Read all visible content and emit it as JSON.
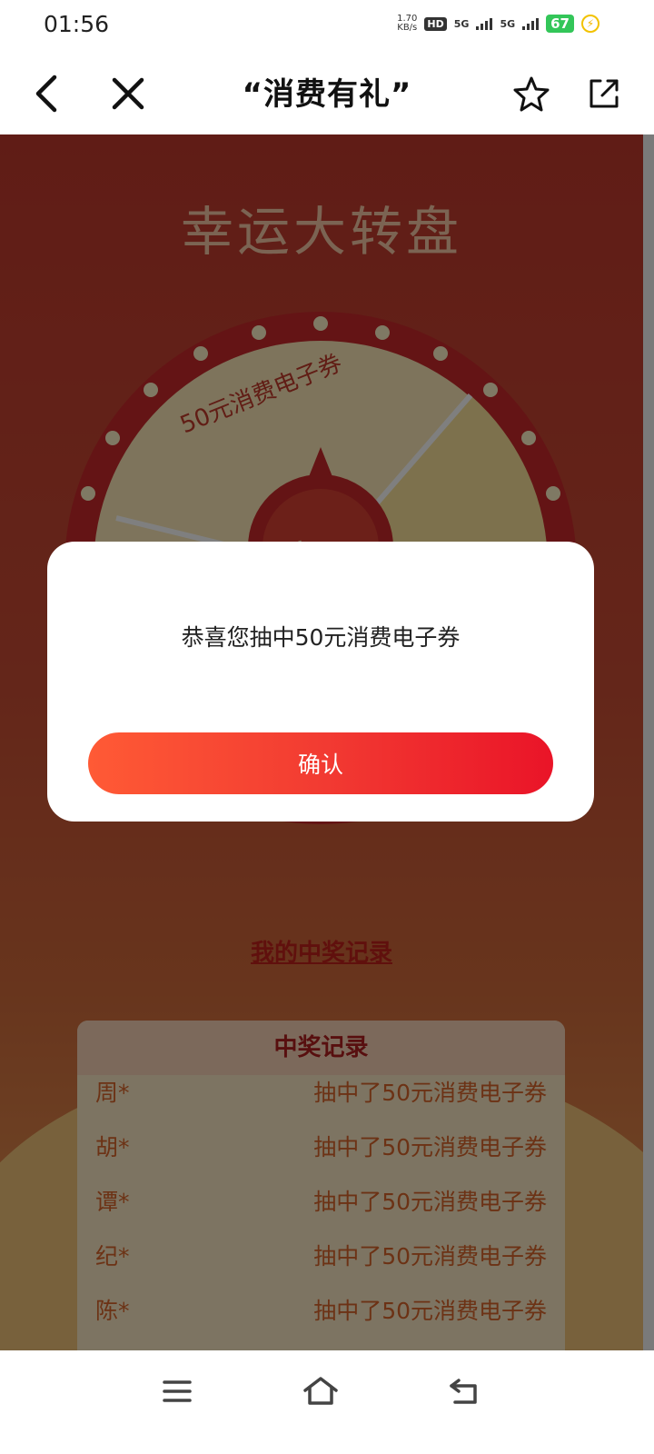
{
  "status_bar": {
    "time": "01:56",
    "net_speed_value": "1.70",
    "net_speed_unit": "KB/s",
    "hd_label": "HD",
    "sim1_label": "5G",
    "sim2_label": "5G",
    "battery": "67"
  },
  "nav": {
    "title": "“消费有礼”",
    "icons": [
      "back-arrow-icon",
      "close-icon",
      "star-icon",
      "share-icon"
    ]
  },
  "page": {
    "heading": "幸运大转盘",
    "wheel_prize_label": "50元消费电子券",
    "start_label": "立即",
    "my_records_link": "我的中奖记录",
    "records_title": "中奖记录",
    "records": [
      {
        "name": "周*",
        "prize": "抽中了50元消费电子券"
      },
      {
        "name": "胡*",
        "prize": "抽中了50元消费电子券"
      },
      {
        "name": "谭*",
        "prize": "抽中了50元消费电子券"
      },
      {
        "name": "纪*",
        "prize": "抽中了50元消费电子券"
      },
      {
        "name": "陈*",
        "prize": "抽中了50元消费电子券"
      }
    ]
  },
  "dialog": {
    "message": "恭喜您抽中50元消费电子券",
    "confirm_label": "确认"
  },
  "system_nav": {
    "icons": [
      "menu-icon",
      "home-icon",
      "back-icon"
    ]
  },
  "colors": {
    "accent_start": "#ff5a35",
    "accent_end": "#ea1428",
    "battery": "#33c659"
  }
}
